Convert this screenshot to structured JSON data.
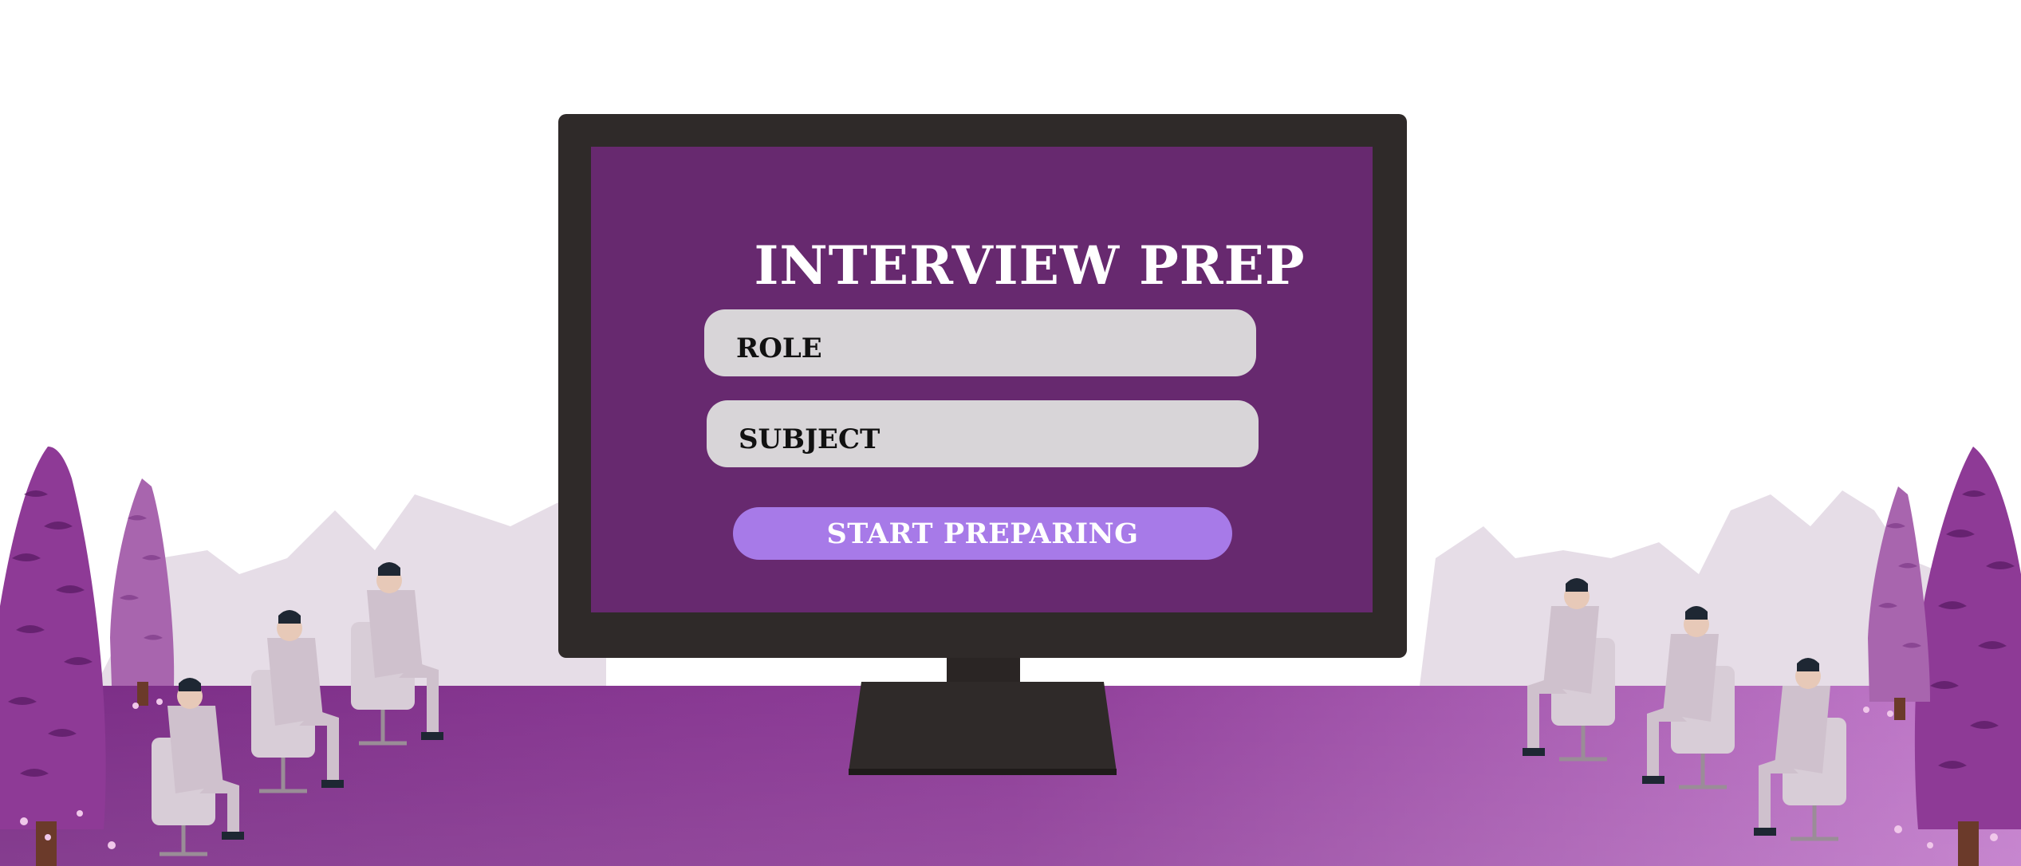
{
  "screen": {
    "title": "INTERVIEW PREP",
    "role_placeholder": "ROLE",
    "subject_placeholder": "SUBJECT",
    "start_label": "START PREPARING"
  },
  "colors": {
    "screen_bg": "#67296f",
    "button_bg": "#a77ae8",
    "field_bg": "#d8d5d8",
    "monitor_frame": "#2f2a29",
    "floor": "#8f3e98",
    "trees": "#9a3fa1"
  }
}
